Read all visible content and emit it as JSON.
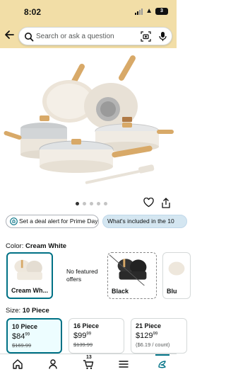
{
  "status_bar": {
    "time": "8:02",
    "battery": "3"
  },
  "search": {
    "placeholder": "Search or ask a question"
  },
  "product_image": {
    "image_dots_count": 5,
    "active_dot": 1
  },
  "actions": {
    "deal_alert_label": "Set a deal alert for Prime Day",
    "included_label": "What's included in the 10"
  },
  "color": {
    "label": "Color:",
    "selected": "Cream White",
    "options": [
      {
        "name": "Cream Wh...",
        "selected": true
      },
      {
        "name": "No featured offers"
      },
      {
        "name": "Black",
        "unavailable": true
      },
      {
        "name": "Blu"
      }
    ]
  },
  "size": {
    "label": "Size:",
    "selected": "10 Piece",
    "options": [
      {
        "name": "10 Piece",
        "price_whole": "$84",
        "price_cents": "99",
        "list_price": "$169.99",
        "selected": true
      },
      {
        "name": "16 Piece",
        "price_whole": "$99",
        "price_cents": "99",
        "list_price": "$139.99"
      },
      {
        "name": "21 Piece",
        "price_whole": "$129",
        "price_cents": "99",
        "unit_price": "($6.19 / count)"
      }
    ]
  },
  "bottom_nav": {
    "cart_count": "13"
  },
  "colors": {
    "header_bg": "#f2dea7",
    "accent": "#007185",
    "pill_blue": "#d4e6f1"
  }
}
